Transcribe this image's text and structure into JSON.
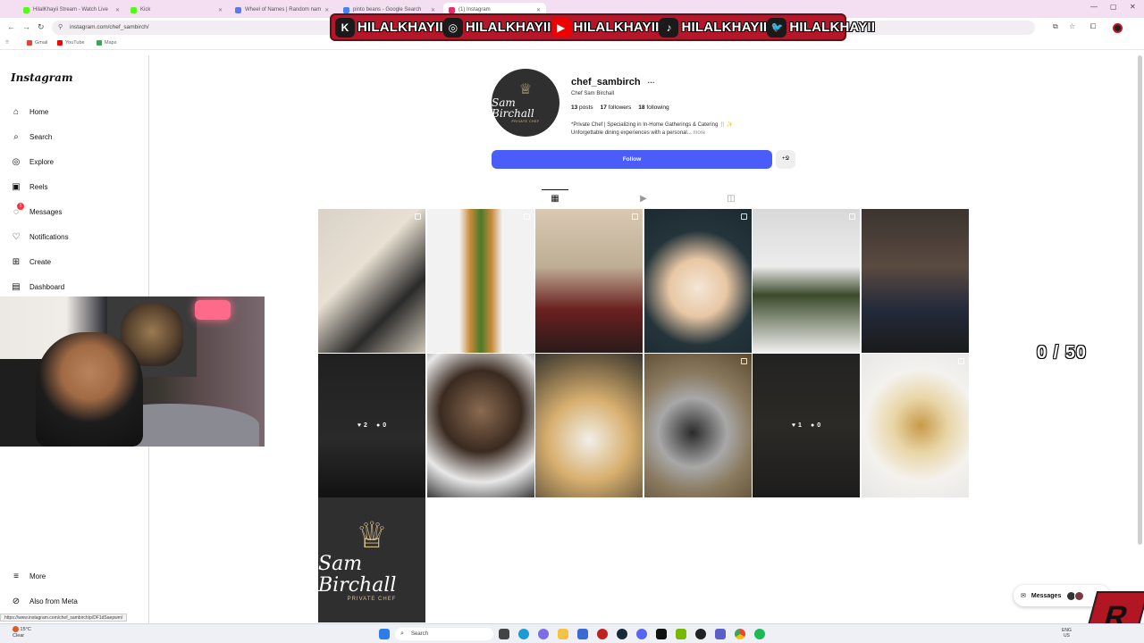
{
  "browser": {
    "tabs": [
      {
        "label": "HilalKhayii Stream - Watch Live",
        "color": "#53fc18"
      },
      {
        "label": "Kick",
        "color": "#53fc18"
      },
      {
        "label": "Wheel of Names | Random nam",
        "color": "#5b7be9"
      },
      {
        "label": "pinto beans - Google Search",
        "color": "#4285f4"
      },
      {
        "label": "(1) Instagram",
        "color": "#e1306c"
      }
    ],
    "url": "instagram.com/chef_sambirch/",
    "bookmarks": [
      "Gmail",
      "YouTube",
      "Maps"
    ]
  },
  "banner": {
    "handle": "HILALKHAYII",
    "platforms": [
      "kick-icon",
      "instagram-icon",
      "youtube-icon",
      "tiktok-icon",
      "twitter-icon"
    ],
    "glyphs": [
      "K",
      "◎",
      "▶",
      "♪",
      "🐦"
    ]
  },
  "sidebar": {
    "logo": "Instagram",
    "items": [
      {
        "label": "Home",
        "icon": "home-icon",
        "glyph": "⌂"
      },
      {
        "label": "Search",
        "icon": "search-icon",
        "glyph": "⌕"
      },
      {
        "label": "Explore",
        "icon": "compass-icon",
        "glyph": "◎"
      },
      {
        "label": "Reels",
        "icon": "reels-icon",
        "glyph": "▣"
      },
      {
        "label": "Messages",
        "icon": "messenger-icon",
        "glyph": "◌",
        "badge": "1"
      },
      {
        "label": "Notifications",
        "icon": "heart-icon",
        "glyph": "♡"
      },
      {
        "label": "Create",
        "icon": "plus-icon",
        "glyph": "⊞"
      },
      {
        "label": "Dashboard",
        "icon": "dashboard-icon",
        "glyph": "▤"
      }
    ],
    "bottom": [
      {
        "label": "More",
        "icon": "menu-icon",
        "glyph": "≡"
      },
      {
        "label": "Also from Meta",
        "icon": "meta-icon",
        "glyph": "⊘"
      }
    ]
  },
  "profile": {
    "username": "chef_sambirch",
    "more_glyph": "···",
    "full_name": "Chef Sam Birchall",
    "stats": {
      "posts": "13",
      "posts_label": "posts",
      "followers": "17",
      "followers_label": "followers",
      "following": "18",
      "following_label": "following"
    },
    "bio_line1": "*Private Chef | Specializing in In-Home Gatherings & Catering 🍴✨",
    "bio_line2": "Unforgettable dining experiences with a personal...",
    "bio_more": "more",
    "follow_label": "Follow",
    "suggest_label": "+Ջ",
    "avatar": {
      "hat": "♕",
      "line1": "Sam Birchall",
      "line2": "PRIVATE CHEF"
    }
  },
  "tabs": [
    {
      "name": "tab-posts",
      "glyph": "▦",
      "active": true
    },
    {
      "name": "tab-reels",
      "glyph": "▶",
      "active": false
    },
    {
      "name": "tab-tagged",
      "glyph": "◫",
      "active": false
    }
  ],
  "posts": [
    {
      "bg": "linear-gradient(135deg,#d8d2c8 0%,#e8e0d2 40%,#2a2a2a 70%,#cfc6b8 100%)",
      "multi": true
    },
    {
      "bg": "linear-gradient(90deg,#f2f2f2 0%,#f2f2f2 30%,#c88a3a 40%,#4a7a2a 50%,#c88a3a 60%,#f2f2f2 70%)",
      "multi": true
    },
    {
      "bg": "linear-gradient(180deg,#d9c9b2 0%,#bfae96 40%,#6a2020 70%,#2a1a1a 100%)",
      "multi": true
    },
    {
      "bg": "radial-gradient(circle at 50% 55%,#f4e6d6 0%,#e8c7a4 30%,#24343a 60%,#1b2a30 100%)",
      "multi": true
    },
    {
      "bg": "linear-gradient(180deg,#d8d8d8 0%,#ececec 40%,#3a4a2a 60%,#f0f0f0 100%)",
      "multi": true
    },
    {
      "bg": "linear-gradient(180deg,#3b3430 0%,#5a4a40 40%,#232a3a 70%,#1a1a1a 100%)",
      "multi": false
    },
    {
      "bg": "linear-gradient(180deg,#202020 0%,#2a2a2a 60%,#121212 100%)",
      "multi": false,
      "likes": "2",
      "comments": "0"
    },
    {
      "bg": "radial-gradient(circle at 50% 40%,#8a6a50 0%,#3a2a20 40%,#e8e8e8 70%,#3a3a3a 100%)",
      "multi": false
    },
    {
      "bg": "radial-gradient(circle at 50% 60%,#f2efe8 0%,#d8b070 40%,#6a5a40 80%,#3a3530 100%)",
      "multi": false
    },
    {
      "bg": "radial-gradient(circle at 45% 55%,#2a2a2a 0%,#a8a8a8 35%,#8a7a60 60%,#5a4a30 100%)",
      "multi": true
    },
    {
      "bg": "linear-gradient(180deg,#222 0%,#2c2a26 50%,#1c1c1c 100%)",
      "multi": false,
      "likes": "1",
      "comments": "0"
    },
    {
      "bg": "radial-gradient(circle at 55% 50%,#c89a4a 0%,#e9d6a8 30%,#f4f2ee 60%,#e6e6e6 100%)",
      "multi": true
    }
  ],
  "logo_post": {
    "hat": "♕",
    "line1": "Sam Birchall",
    "line2": "PRIVATE CHEF"
  },
  "counter": "0 / 50",
  "messages_pill": {
    "label": "Messages",
    "badge": "1"
  },
  "status_url": "https://www.instagram.com/chef_sambirch/p/DF1dSaepwm/",
  "overlay_logo": "R",
  "taskbar": {
    "weather_temp": "15°C",
    "weather_desc": "Clear",
    "search_label": "Search",
    "lang": "ENG",
    "region": "US"
  }
}
